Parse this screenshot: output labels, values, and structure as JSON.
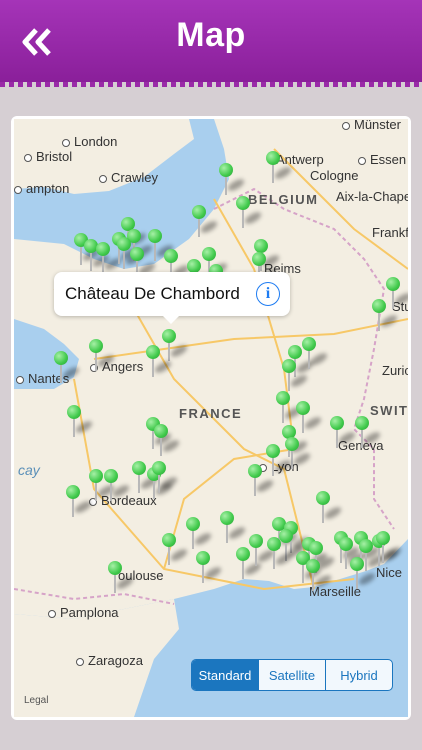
{
  "nav": {
    "title": "Map",
    "back_icon": "double-chevron-left-icon",
    "color_top": "#a534b8",
    "color_bottom": "#8a1f9a"
  },
  "map": {
    "callout": {
      "title": "Château De Chambord",
      "info_icon": "info-icon",
      "info_glyph": "i"
    },
    "labels": {
      "country_france": "FRANCE",
      "country_belgium": "BELGIUM",
      "country_switzerland": "SWITZ",
      "sea_biscay": "cay",
      "cities": [
        "Münster",
        "London",
        "Bristol",
        "Crawley",
        "ampton",
        "Antwerp",
        "Essen",
        "Cologne",
        "Aix-la-Chape",
        "Frankfu",
        "Reims",
        "Stu",
        "Nantes",
        "Angers",
        "Zuric",
        "Geneva",
        "Lyon",
        "Bordeaux",
        "oulouse",
        "Marseille",
        "Nice",
        "Pamplona",
        "Zaragoza"
      ]
    },
    "segmented": {
      "options": [
        "Standard",
        "Satellite",
        "Hybrid"
      ],
      "selected": "Standard"
    },
    "legal": "Legal",
    "pin_color": "#3fc94a"
  }
}
